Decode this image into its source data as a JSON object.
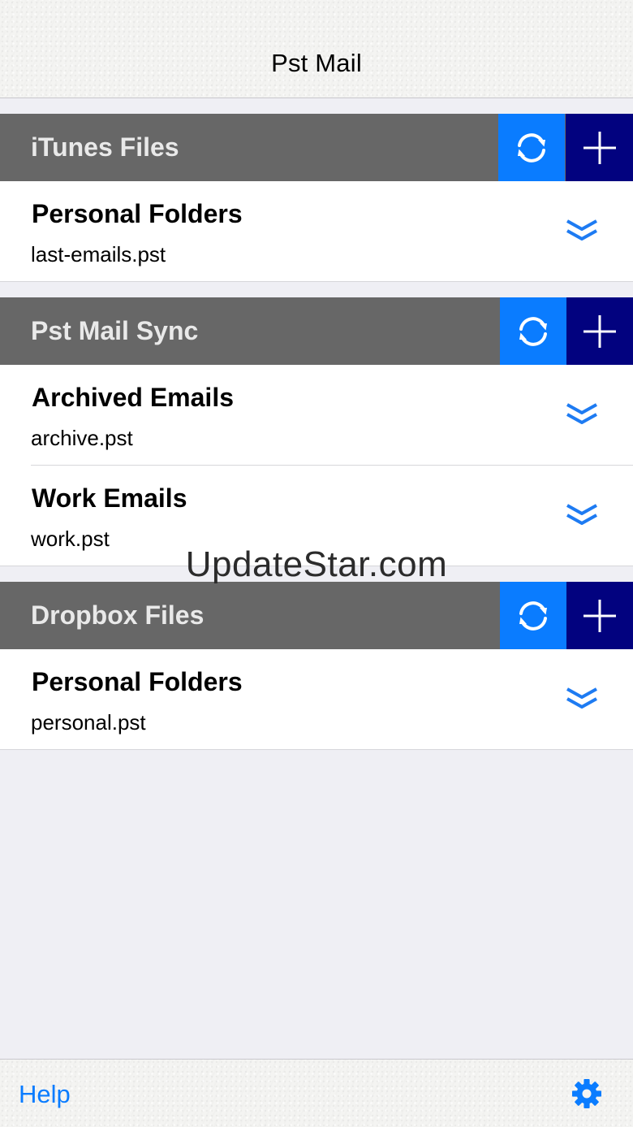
{
  "app": {
    "title": "Pst Mail"
  },
  "sections": [
    {
      "title": "iTunes Files",
      "refresh_icon": "refresh-icon",
      "add_icon": "plus-icon",
      "items": [
        {
          "title": "Personal Folders",
          "subtitle": "last-emails.pst",
          "icon": "chevron-double-down-icon"
        }
      ]
    },
    {
      "title": "Pst Mail Sync",
      "refresh_icon": "refresh-icon",
      "add_icon": "plus-icon",
      "items": [
        {
          "title": "Archived Emails",
          "subtitle": "archive.pst",
          "icon": "chevron-double-down-icon"
        },
        {
          "title": "Work Emails",
          "subtitle": "work.pst",
          "icon": "chevron-double-down-icon"
        }
      ]
    },
    {
      "title": "Dropbox Files",
      "refresh_icon": "refresh-icon",
      "add_icon": "plus-icon",
      "items": [
        {
          "title": "Personal Folders",
          "subtitle": "personal.pst",
          "icon": "chevron-double-down-icon"
        }
      ]
    }
  ],
  "watermark": "UpdateStar.com",
  "toolbar": {
    "help_label": "Help",
    "settings_icon": "gear-icon"
  },
  "colors": {
    "section_header_bg": "#676767",
    "refresh_button_bg": "#0a7cff",
    "add_button_bg": "#02027f",
    "accent": "#0a7cff",
    "chevron": "#1e7bf2"
  }
}
